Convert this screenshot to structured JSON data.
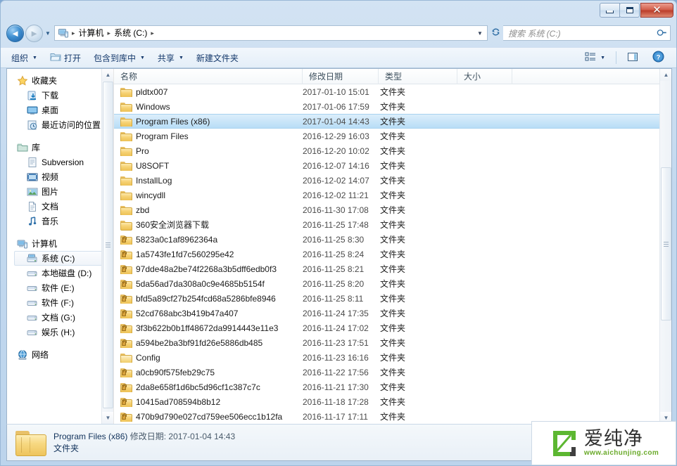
{
  "window": {
    "controls": {
      "minimize": "–",
      "maximize": "□",
      "close": "✕"
    }
  },
  "address": {
    "back_title": "后退",
    "forward_title": "前进",
    "history_caret": "▼",
    "computer_icon": "computer-icon",
    "crumbs": [
      "计算机",
      "系统 (C:)"
    ],
    "separator": "▸",
    "refresh": "↻",
    "dropdown_caret": "▼"
  },
  "search": {
    "placeholder": "搜索 系统 (C:)",
    "icon": "search-icon"
  },
  "toolbar": {
    "organize": "组织",
    "open": "打开",
    "include_library": "包含到库中",
    "share": "共享",
    "new_folder": "新建文件夹",
    "caret": "▼",
    "view_icon": "view-list-icon",
    "preview_icon": "preview-pane-icon",
    "help_icon": "help-icon"
  },
  "sidebar": {
    "groups": [
      {
        "header": {
          "label": "收藏夹",
          "icon": "star-icon"
        },
        "items": [
          {
            "label": "下载",
            "icon": "downloads-icon"
          },
          {
            "label": "桌面",
            "icon": "desktop-icon"
          },
          {
            "label": "最近访问的位置",
            "icon": "recent-places-icon"
          }
        ]
      },
      {
        "header": {
          "label": "库",
          "icon": "library-icon"
        },
        "items": [
          {
            "label": "Subversion",
            "icon": "subversion-icon"
          },
          {
            "label": "视频",
            "icon": "videos-icon"
          },
          {
            "label": "图片",
            "icon": "pictures-icon"
          },
          {
            "label": "文档",
            "icon": "documents-icon"
          },
          {
            "label": "音乐",
            "icon": "music-icon"
          }
        ]
      },
      {
        "header": {
          "label": "计算机",
          "icon": "computer-icon"
        },
        "items": [
          {
            "label": "系统 (C:)",
            "icon": "system-drive-icon",
            "selected": true
          },
          {
            "label": "本地磁盘 (D:)",
            "icon": "drive-icon"
          },
          {
            "label": "软件 (E:)",
            "icon": "drive-icon"
          },
          {
            "label": "软件 (F:)",
            "icon": "drive-icon"
          },
          {
            "label": "文档 (G:)",
            "icon": "drive-icon"
          },
          {
            "label": "娱乐 (H:)",
            "icon": "drive-icon"
          }
        ]
      },
      {
        "header": {
          "label": "网络",
          "icon": "network-icon"
        },
        "items": []
      }
    ]
  },
  "filelist": {
    "columns": [
      "名称",
      "修改日期",
      "类型",
      "大小"
    ],
    "rows": [
      {
        "name": "pldtx007",
        "date": "2017-01-10 15:01",
        "type": "文件夹",
        "size": "",
        "icon": "folder-icon",
        "selected": false
      },
      {
        "name": "Windows",
        "date": "2017-01-06 17:59",
        "type": "文件夹",
        "size": "",
        "icon": "folder-icon",
        "selected": false
      },
      {
        "name": "Program Files (x86)",
        "date": "2017-01-04 14:43",
        "type": "文件夹",
        "size": "",
        "icon": "folder-icon",
        "selected": true
      },
      {
        "name": "Program Files",
        "date": "2016-12-29 16:03",
        "type": "文件夹",
        "size": "",
        "icon": "folder-icon",
        "selected": false
      },
      {
        "name": "Pro",
        "date": "2016-12-20 10:02",
        "type": "文件夹",
        "size": "",
        "icon": "folder-icon",
        "selected": false
      },
      {
        "name": "U8SOFT",
        "date": "2016-12-07 14:16",
        "type": "文件夹",
        "size": "",
        "icon": "folder-icon",
        "selected": false
      },
      {
        "name": "InstallLog",
        "date": "2016-12-02 14:07",
        "type": "文件夹",
        "size": "",
        "icon": "folder-icon",
        "selected": false
      },
      {
        "name": "wincydll",
        "date": "2016-12-02 11:21",
        "type": "文件夹",
        "size": "",
        "icon": "folder-icon",
        "selected": false
      },
      {
        "name": "zbd",
        "date": "2016-11-30 17:08",
        "type": "文件夹",
        "size": "",
        "icon": "folder-icon",
        "selected": false
      },
      {
        "name": "360安全浏览器下载",
        "date": "2016-11-25 17:48",
        "type": "文件夹",
        "size": "",
        "icon": "folder-icon",
        "selected": false
      },
      {
        "name": "5823a0c1af8962364a",
        "date": "2016-11-25 8:30",
        "type": "文件夹",
        "size": "",
        "icon": "folder-locked-icon",
        "selected": false
      },
      {
        "name": "1a5743fe1fd7c560295e42",
        "date": "2016-11-25 8:24",
        "type": "文件夹",
        "size": "",
        "icon": "folder-locked-icon",
        "selected": false
      },
      {
        "name": "97dde48a2be74f2268a3b5dff6edb0f3",
        "date": "2016-11-25 8:21",
        "type": "文件夹",
        "size": "",
        "icon": "folder-locked-icon",
        "selected": false
      },
      {
        "name": "5da56ad7da308a0c9e4685b5154f",
        "date": "2016-11-25 8:20",
        "type": "文件夹",
        "size": "",
        "icon": "folder-locked-icon",
        "selected": false
      },
      {
        "name": "bfd5a89cf27b254fcd68a5286bfe8946",
        "date": "2016-11-25 8:11",
        "type": "文件夹",
        "size": "",
        "icon": "folder-locked-icon",
        "selected": false
      },
      {
        "name": "52cd768abc3b419b47a407",
        "date": "2016-11-24 17:35",
        "type": "文件夹",
        "size": "",
        "icon": "folder-locked-icon",
        "selected": false
      },
      {
        "name": "3f3b622b0b1ff48672da9914443e11e3",
        "date": "2016-11-24 17:02",
        "type": "文件夹",
        "size": "",
        "icon": "folder-locked-icon",
        "selected": false
      },
      {
        "name": "a594be2ba3bf91fd26e5886db485",
        "date": "2016-11-23 17:51",
        "type": "文件夹",
        "size": "",
        "icon": "folder-locked-icon",
        "selected": false
      },
      {
        "name": "Config",
        "date": "2016-11-23 16:16",
        "type": "文件夹",
        "size": "",
        "icon": "folder-open-icon",
        "selected": false
      },
      {
        "name": "a0cb90f575feb29c75",
        "date": "2016-11-22 17:56",
        "type": "文件夹",
        "size": "",
        "icon": "folder-locked-icon",
        "selected": false
      },
      {
        "name": "2da8e658f1d6bc5d96cf1c387c7c",
        "date": "2016-11-21 17:30",
        "type": "文件夹",
        "size": "",
        "icon": "folder-locked-icon",
        "selected": false
      },
      {
        "name": "10415ad708594b8b12",
        "date": "2016-11-18 17:28",
        "type": "文件夹",
        "size": "",
        "icon": "folder-locked-icon",
        "selected": false
      },
      {
        "name": "470b9d790e027cd759ee506ecc1b12fa",
        "date": "2016-11-17 17:11",
        "type": "文件夹",
        "size": "",
        "icon": "folder-locked-icon",
        "selected": false
      }
    ]
  },
  "status": {
    "name": "Program Files (x86)",
    "date_label": "修改日期:",
    "date_value": "2017-01-04 14:43",
    "type": "文件夹",
    "icon": "folder-large-icon"
  },
  "watermark": {
    "brand": "爱纯净",
    "url": "www.aichunjing.com",
    "logo_color": "#5cb731"
  }
}
